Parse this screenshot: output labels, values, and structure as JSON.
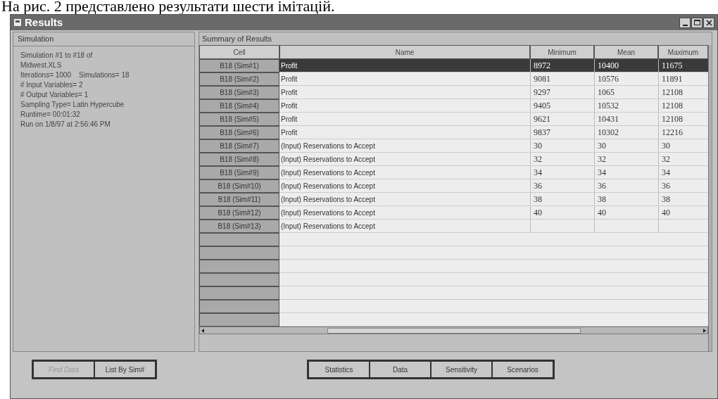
{
  "caption": "На рис. 2 представлено результати шести імітацій.",
  "window": {
    "title": "Results"
  },
  "simulation_panel": {
    "title": "Simulation",
    "lines": [
      "Simulation #1 to #18 of",
      "Midwest.XLS",
      "Iterations= 1000    Simulations= 18",
      "# Input Variables= 2",
      "# Output Variables= 1",
      "Sampling Type= Latin Hypercube",
      "Runtime= 00:01:32",
      "Run on 1/8/97 at 2:56:46 PM"
    ]
  },
  "summary": {
    "title": "Summary of Results",
    "columns": [
      "Cell",
      "Name",
      "Minimum",
      "Mean",
      "Maximum"
    ],
    "rows": [
      {
        "cell": "B18 (Sim#1)",
        "name": "Profit",
        "minimum": "8972",
        "mean": "10400",
        "maximum": "11675",
        "selected": true
      },
      {
        "cell": "B18 (Sim#2)",
        "name": "Profit",
        "minimum": "9081",
        "mean": "10576",
        "maximum": "11891",
        "selected": false
      },
      {
        "cell": "B18 (Sim#3)",
        "name": "Profit",
        "minimum": "9297",
        "mean": "1065",
        "maximum": "12108",
        "selected": false
      },
      {
        "cell": "B18 (Sim#4)",
        "name": "Profit",
        "minimum": "9405",
        "mean": "10532",
        "maximum": "12108",
        "selected": false
      },
      {
        "cell": "B18 (Sim#5)",
        "name": "Profit",
        "minimum": "9621",
        "mean": "10431",
        "maximum": "12108",
        "selected": false
      },
      {
        "cell": "B18 (Sim#6)",
        "name": "Profit",
        "minimum": "9837",
        "mean": "10302",
        "maximum": "12216",
        "selected": false
      },
      {
        "cell": "B18 (Sim#7)",
        "name": "(Input) Reservations to Accept",
        "minimum": "30",
        "mean": "30",
        "maximum": "30",
        "selected": false
      },
      {
        "cell": "B18 (Sim#8)",
        "name": "(Input) Reservations to Accept",
        "minimum": "32",
        "mean": "32",
        "maximum": "32",
        "selected": false
      },
      {
        "cell": "B18 (Sim#9)",
        "name": "(Input) Reservations to Accept",
        "minimum": "34",
        "mean": "34",
        "maximum": "34",
        "selected": false
      },
      {
        "cell": "B18 (Sim#10)",
        "name": "(Input) Reservations to Accept",
        "minimum": "36",
        "mean": "36",
        "maximum": "36",
        "selected": false
      },
      {
        "cell": "B18 (Sim#11)",
        "name": "(Input) Reservations to Accept",
        "minimum": "38",
        "mean": "38",
        "maximum": "38",
        "selected": false
      },
      {
        "cell": "B18 (Sim#12)",
        "name": "(Input) Reservations to Accept",
        "minimum": "40",
        "mean": "40",
        "maximum": "40",
        "selected": false
      },
      {
        "cell": "B18 (Sim#13)",
        "name": "(Input) Reservations to Accept",
        "selected": false
      }
    ]
  },
  "left_buttons": [
    {
      "label": "Find Data",
      "disabled": true
    },
    {
      "label": "List By Sim#",
      "disabled": false
    }
  ],
  "view_buttons": [
    "Statistics",
    "Data",
    "Sensitivity",
    "Scenarios"
  ]
}
